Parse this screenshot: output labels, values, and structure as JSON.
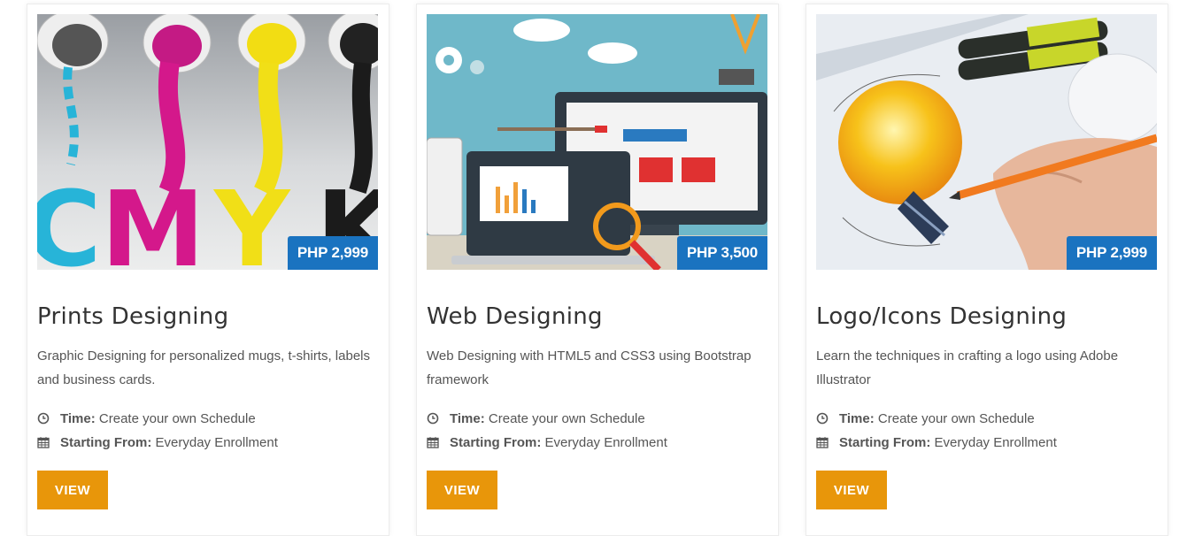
{
  "courses": [
    {
      "title": "Prints Designing",
      "price": "PHP 2,999",
      "description": "Graphic Designing for personalized mugs, t-shirts, labels and business cards.",
      "time_label": "Time:",
      "time_value": "Create your own Schedule",
      "start_label": "Starting From:",
      "start_value": "Everyday Enrollment",
      "button": "VIEW",
      "image_letters": "CMYK"
    },
    {
      "title": "Web Designing",
      "price": "PHP 3,500",
      "description": "Web Designing with HTML5 and CSS3 using Bootstrap framework",
      "time_label": "Time:",
      "time_value": "Create your own Schedule",
      "start_label": "Starting From:",
      "start_value": "Everyday Enrollment",
      "button": "VIEW"
    },
    {
      "title": "Logo/Icons Designing",
      "price": "PHP 2,999",
      "description": "Learn the techniques in crafting a logo using Adobe Illustrator",
      "time_label": "Time:",
      "time_value": "Create your own Schedule",
      "start_label": "Starting From:",
      "start_value": "Everyday Enrollment",
      "button": "VIEW"
    }
  ],
  "colors": {
    "price_badge": "#1a73c0",
    "button": "#e8960a",
    "title": "#333333",
    "text": "#555555"
  },
  "icons": {
    "time": "clock-icon",
    "start": "calendar-icon"
  }
}
